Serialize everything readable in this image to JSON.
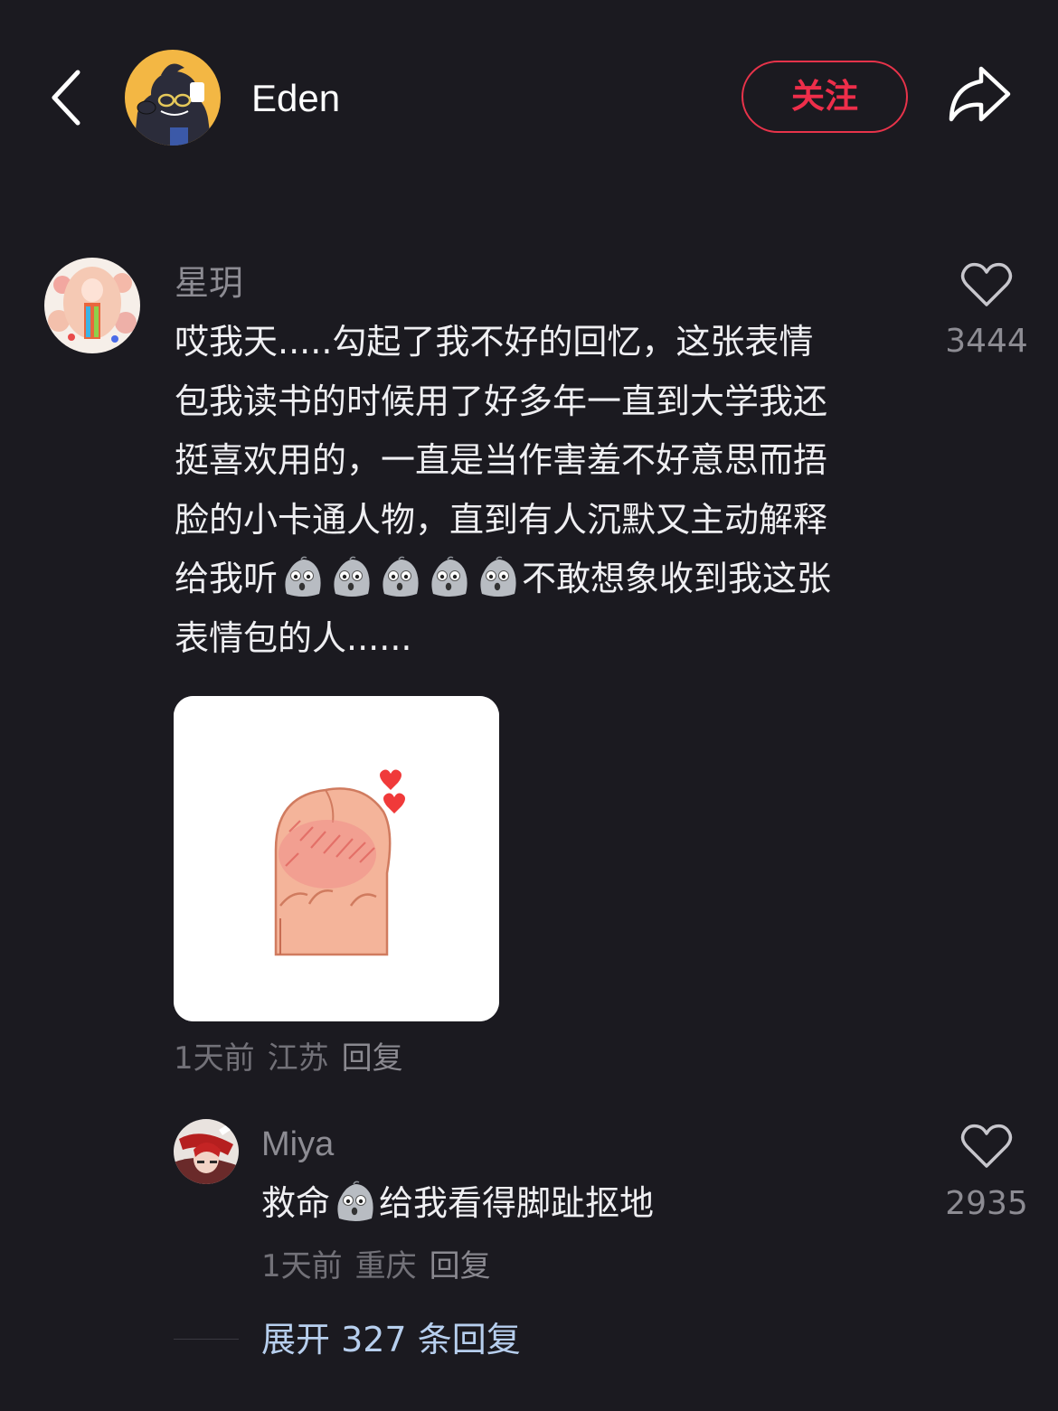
{
  "header": {
    "author_name": "Eden",
    "follow_label": "关注"
  },
  "comment": {
    "username": "星玥",
    "text_lines": [
      "哎我天.....勾起了我不好的回忆，这张表情",
      "包我读书的时候用了好多年一直到大学我还",
      "挺喜欢用的，一直是当作害羞不好意思而捂",
      "脸的小卡通人物，直到有人沉默又主动解释"
    ],
    "line5_prefix": "给我听",
    "line5_emoji_count": 5,
    "line5_suffix": "不敢想象收到我这张",
    "line6": "表情包的人......",
    "like_count": "3444",
    "time": "1天前",
    "location": "江苏",
    "reply_label": "回复"
  },
  "reply": {
    "username": "Miya",
    "text_prefix": "救命",
    "text_suffix": "给我看得脚趾抠地",
    "like_count": "2935",
    "time": "1天前",
    "location": "重庆",
    "reply_label": "回复"
  },
  "expand_label": "展开 327 条回复",
  "icons": {
    "back": "chevron-left-icon",
    "share": "share-arrow-icon",
    "like": "heart-outline-icon",
    "emoji": "gray-blob-emoji"
  },
  "colors": {
    "background": "#1b1a20",
    "accent": "#ee2e4a",
    "link": "#b7cfee"
  }
}
